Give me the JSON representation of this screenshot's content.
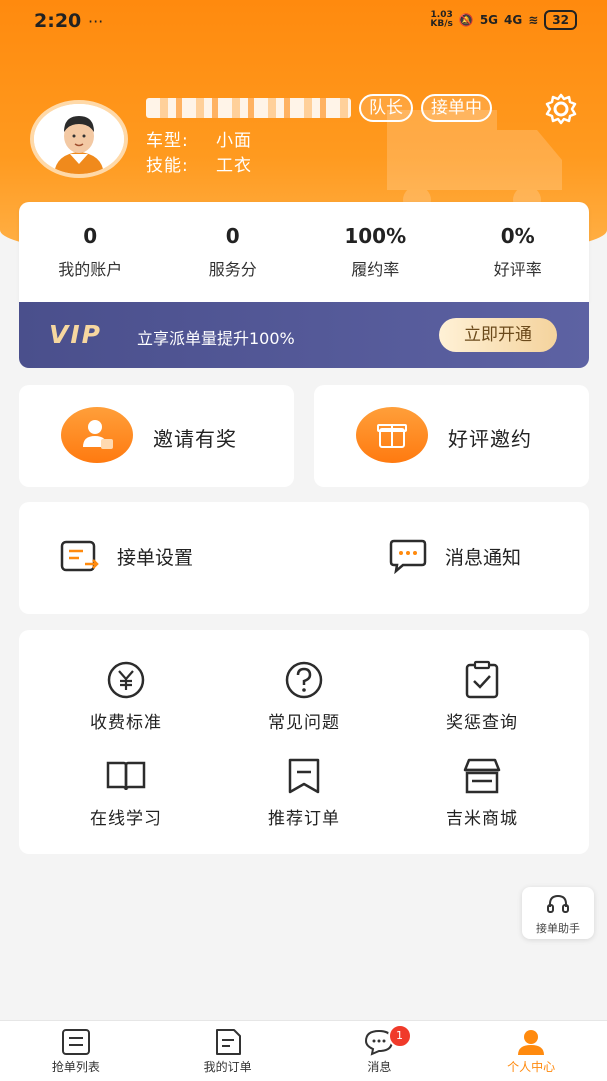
{
  "status_bar": {
    "time": "2:20",
    "left_icons": "···",
    "net_speed_value": "1.03",
    "net_speed_unit": "KB/s",
    "signal1": "5G",
    "signal2": "4G",
    "battery": "32"
  },
  "profile": {
    "tags": [
      "队长",
      "接单中"
    ],
    "vehicle_label": "车型:",
    "vehicle_value": "小面",
    "skill_label": "技能:",
    "skill_value": "工衣"
  },
  "stats": [
    {
      "value": "0",
      "label": "我的账户"
    },
    {
      "value": "0",
      "label": "服务分"
    },
    {
      "value": "100%",
      "label": "履约率"
    },
    {
      "value": "0%",
      "label": "好评率"
    }
  ],
  "vip": {
    "logo": "VIP",
    "text": "立享派单量提升100%",
    "button": "立即开通"
  },
  "shortcuts": [
    {
      "label": "邀请有奖",
      "icon": "person-card-icon"
    },
    {
      "label": "好评邀约",
      "icon": "gift-icon"
    }
  ],
  "settings": [
    {
      "label": "接单设置",
      "icon": "order-settings-icon"
    },
    {
      "label": "消息通知",
      "icon": "chat-bubble-icon"
    }
  ],
  "tools": [
    {
      "label": "收费标准",
      "icon": "yen-icon"
    },
    {
      "label": "常见问题",
      "icon": "question-icon"
    },
    {
      "label": "奖惩查询",
      "icon": "clipboard-check-icon"
    },
    {
      "label": "在线学习",
      "icon": "book-icon"
    },
    {
      "label": "推荐订单",
      "icon": "bookmark-icon"
    },
    {
      "label": "吉米商城",
      "icon": "store-icon"
    }
  ],
  "assistant": {
    "label": "接单助手"
  },
  "tabbar": [
    {
      "label": "抢单列表",
      "active": false
    },
    {
      "label": "我的订单",
      "active": false
    },
    {
      "label": "消息",
      "active": false,
      "badge": "1"
    },
    {
      "label": "个人中心",
      "active": true
    }
  ],
  "colors": {
    "brand_orange": "#ff8a0e",
    "vip_bg": "#4a4f8c",
    "badge_red": "#f03a2a"
  }
}
